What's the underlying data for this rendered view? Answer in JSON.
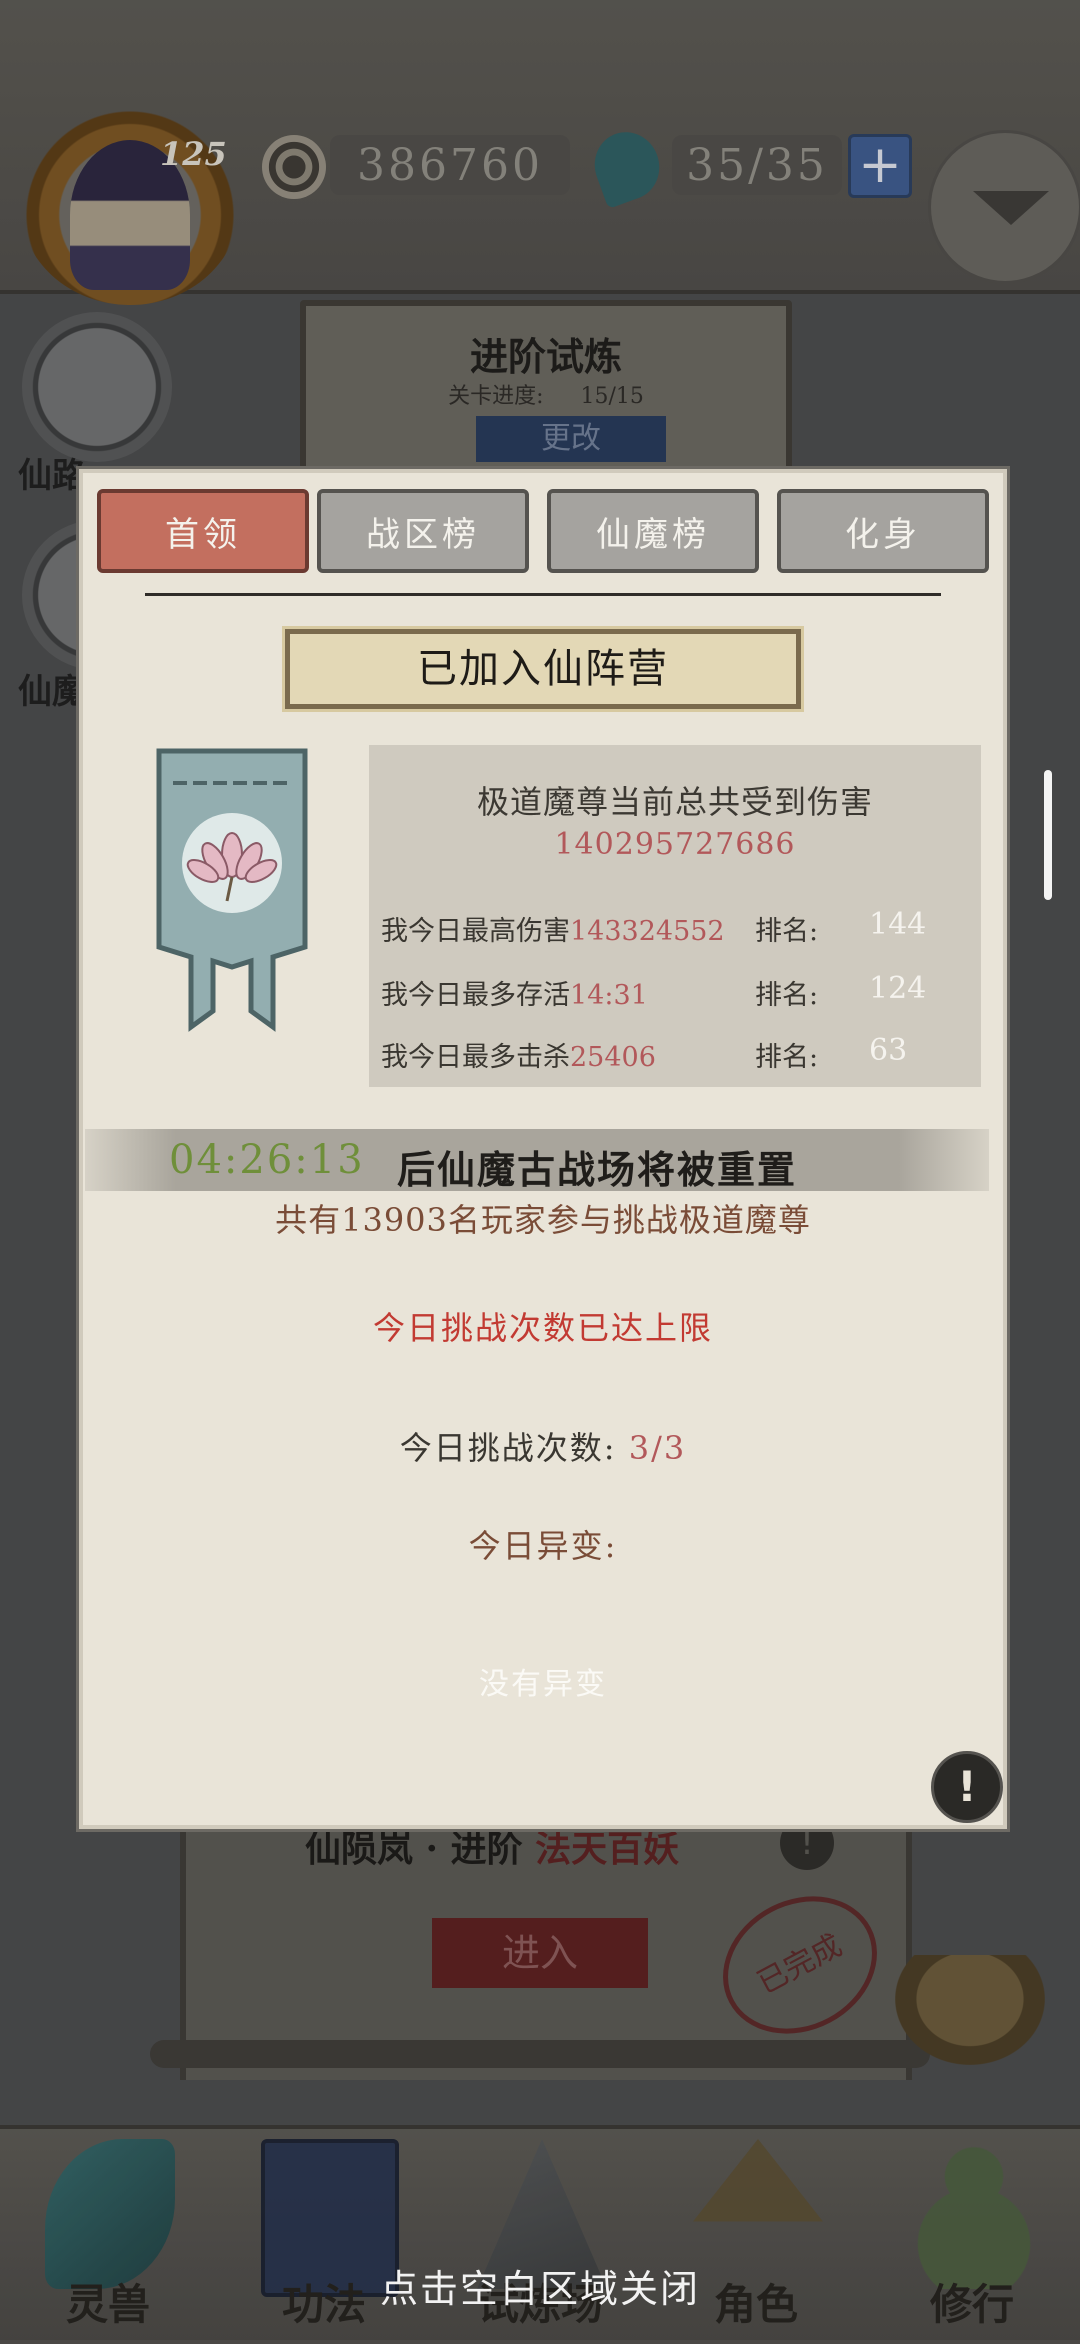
{
  "header": {
    "level": "125",
    "coins": "386760",
    "stamina": "35/35",
    "plus_label": "+"
  },
  "background": {
    "side_items": [
      {
        "label": "仙路"
      },
      {
        "label": "仙魔"
      }
    ],
    "trial": {
      "title": "进阶试炼",
      "progress_label": "关卡进度:",
      "progress_value": "15/15",
      "change_label": "更改"
    },
    "lower": {
      "title_a": "仙陨岚 · 进阶",
      "title_b": "法天百妖",
      "enter_label": "进入",
      "stamp_text": "已完成"
    }
  },
  "tabs": [
    {
      "label": "首领",
      "active": true
    },
    {
      "label": "战区榜",
      "active": false
    },
    {
      "label": "仙魔榜",
      "active": false
    },
    {
      "label": "化身",
      "active": false
    }
  ],
  "camp_banner": "已加入仙阵营",
  "stats": {
    "title": "极道魔尊当前总共受到伤害",
    "total_damage": "140295727686",
    "rows": [
      {
        "label": "我今日最高伤害",
        "value": "143324552",
        "rank_label": "排名:",
        "rank": "144"
      },
      {
        "label": "我今日最多存活",
        "value": "14:31",
        "rank_label": "排名:",
        "rank": "124"
      },
      {
        "label": "我今日最多击杀",
        "value": "25406",
        "rank_label": "排名:",
        "rank": "63"
      }
    ]
  },
  "reset": {
    "timer": "04:26:13",
    "text": "后仙魔古战场将被重置"
  },
  "players_line": "共有13903名玩家参与挑战极道魔尊",
  "limit_notice": "今日挑战次数已达上限",
  "challenge_count": {
    "label": "今日挑战次数:",
    "value": "3/3"
  },
  "mutation": {
    "label": "今日异变:",
    "value": "没有异变"
  },
  "info_icon": "!",
  "bottom_nav": [
    {
      "label": "灵兽",
      "icon": "feather-icon"
    },
    {
      "label": "功法",
      "icon": "book-icon"
    },
    {
      "label": "试炼场",
      "icon": "mountain-icon"
    },
    {
      "label": "角色",
      "icon": "hat-icon"
    },
    {
      "label": "修行",
      "icon": "gourd-icon"
    }
  ],
  "close_hint": "点击空白区域关闭",
  "colors": {
    "active_tab": "#c36f5f",
    "inactive_tab": "#a5a39f",
    "panel": "#e9e4d8",
    "value_red": "#b2585a",
    "timer_green": "#6f8f3a",
    "limit_red": "#c23a32"
  }
}
